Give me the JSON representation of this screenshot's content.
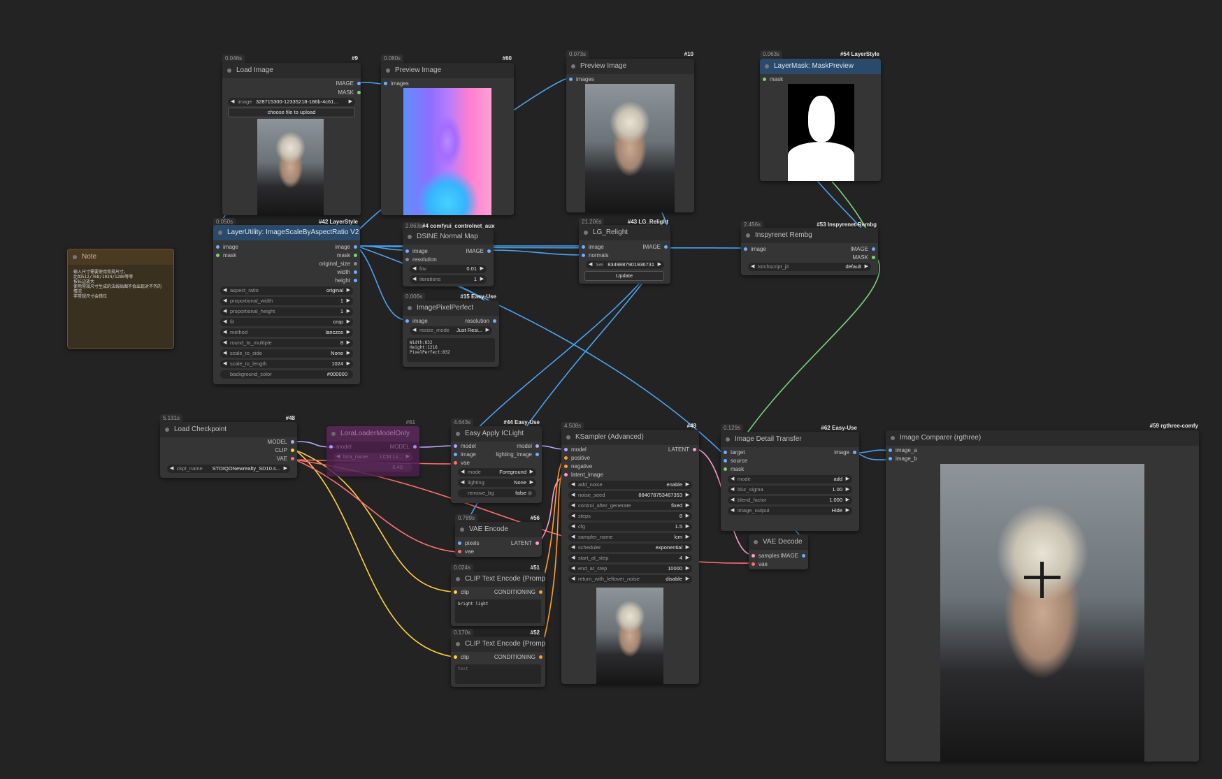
{
  "canvas": {
    "background": "#232323"
  },
  "nodes": {
    "load_image": {
      "time": "0.046s",
      "id": "#9",
      "title": "Load Image",
      "outputs": [
        "IMAGE",
        "MASK"
      ],
      "widget_image_label": "image",
      "widget_image_value": "328715300-12335218-186b-4c61...",
      "upload_button": "choose file to upload"
    },
    "preview_image_60": {
      "time": "0.080s",
      "id": "#60",
      "title": "Preview Image",
      "input": "images"
    },
    "preview_image_10": {
      "time": "0.073s",
      "id": "#10",
      "title": "Preview Image",
      "input": "images"
    },
    "mask_preview": {
      "time": "0.063s",
      "id": "#54 LayerStyle",
      "title": "LayerMask: MaskPreview",
      "input": "mask"
    },
    "scale_by_aspect": {
      "time": "0.050s",
      "id": "#42 LayerStyle",
      "title": "LayerUtility: ImageScaleByAspectRatio V2",
      "inputs": [
        "image",
        "mask"
      ],
      "outputs": [
        "image",
        "mask",
        "original_size",
        "width",
        "height"
      ],
      "widgets": [
        {
          "label": "aspect_ratio",
          "value": "original"
        },
        {
          "label": "proportional_width",
          "value": "1"
        },
        {
          "label": "proportional_height",
          "value": "1"
        },
        {
          "label": "fit",
          "value": "crop"
        },
        {
          "label": "method",
          "value": "lanczos"
        },
        {
          "label": "round_to_multiple",
          "value": "8"
        },
        {
          "label": "scale_to_side",
          "value": "None"
        },
        {
          "label": "scale_to_length",
          "value": "1024"
        },
        {
          "label": "background_color",
          "value": "#000000"
        }
      ]
    },
    "note": {
      "title": "Note",
      "text": "输入尺寸需要使用常规尺寸，\n比如512/768/1024/1280等等\n按长边放大\n使用常规尺寸生成的法线贴图不会出现对不齐的\n情况\n非常规尺寸会错位"
    },
    "dsine": {
      "time": "2.863s",
      "id": "#4 comfyui_controlnet_aux",
      "title": "DSINE Normal Map",
      "inputs": [
        "image",
        "resolution"
      ],
      "output": "IMAGE",
      "widgets": [
        {
          "label": "fov",
          "value": "0.01"
        },
        {
          "label": "iterations",
          "value": "1"
        }
      ]
    },
    "pixel_perfect": {
      "time": "0.006s",
      "id": "#15 Easy-Use",
      "title": "ImagePixelPerfect",
      "input": "image",
      "output": "resolution",
      "widget": {
        "label": "resize_mode",
        "value": "Just Resi..."
      },
      "text": "Width:832\nHeight:1216\nPixelPerfect:832"
    },
    "lg_relight": {
      "time": "21.206s",
      "id": "#43 LG_Relight",
      "title": "LG_Relight",
      "inputs": [
        "image",
        "normals"
      ],
      "output": "IMAGE",
      "widget_seed_label": "Sei",
      "widget_seed_value": "83498879019367​31",
      "update_button": "Update"
    },
    "rembg": {
      "time": "2.456s",
      "id": "#53 Inspyrenet-Rembg",
      "title": "Inspyrenet Rembg",
      "input": "image",
      "outputs": [
        "IMAGE",
        "MASK"
      ],
      "widget": {
        "label": "torchscript_jit",
        "value": "default"
      }
    },
    "load_checkpoint": {
      "time": "5.131s",
      "id": "#48",
      "title": "Load Checkpoint",
      "outputs": [
        "MODEL",
        "CLIP",
        "VAE"
      ],
      "widget": {
        "label": "ckpt_name",
        "value": "STOIQONewrealty_SD10.s..."
      }
    },
    "lora_loader": {
      "id": "#61",
      "title": "LoraLoaderModelOnly",
      "input": "model",
      "output": "MODEL",
      "widget1": {
        "label": "lora_name",
        "value": "LCM Lo..."
      },
      "widget2_value": "0.40"
    },
    "iclight": {
      "time": "4.643s",
      "id": "#44 Easy-Use",
      "title": "Easy Apply ICLight",
      "inputs": [
        "model",
        "image",
        "vae"
      ],
      "outputs": [
        "model",
        "lighting_image"
      ],
      "widgets": [
        {
          "label": "mode",
          "value": "Foreground"
        },
        {
          "label": "lighting",
          "value": "None"
        },
        {
          "label": "remove_bg",
          "value": "false"
        }
      ]
    },
    "vae_encode": {
      "time": "0.789s",
      "id": "#56",
      "title": "VAE Encode",
      "inputs": [
        "pixels",
        "vae"
      ],
      "output": "LATENT"
    },
    "clip_pos": {
      "time": "0.024s",
      "id": "#51",
      "title": "CLIP Text Encode (Prompt)",
      "input": "clip",
      "output": "CONDITIONING",
      "text": "bright light"
    },
    "clip_neg": {
      "time": "0.170s",
      "id": "#52",
      "title": "CLIP Text Encode (Prompt)",
      "input": "clip",
      "output": "CONDITIONING",
      "text": "text"
    },
    "ksampler": {
      "time": "4.508s",
      "id": "#49",
      "title": "KSampler (Advanced)",
      "inputs": [
        "model",
        "positive",
        "negative",
        "latent_image"
      ],
      "output": "LATENT",
      "widgets": [
        {
          "label": "add_noise",
          "value": "enable"
        },
        {
          "label": "noise_seed",
          "value": "884078753467353"
        },
        {
          "label": "control_after_generate",
          "value": "fixed"
        },
        {
          "label": "steps",
          "value": "8"
        },
        {
          "label": "cfg",
          "value": "1.5"
        },
        {
          "label": "sampler_name",
          "value": "lcm"
        },
        {
          "label": "scheduler",
          "value": "exponential"
        },
        {
          "label": "start_at_step",
          "value": "4"
        },
        {
          "label": "end_at_step",
          "value": "10000"
        },
        {
          "label": "return_with_leftover_noise",
          "value": "disable"
        }
      ]
    },
    "detail_transfer": {
      "time": "0.129s",
      "id": "#62 Easy-Use",
      "title": "Image Detail Transfer",
      "inputs": [
        "target",
        "source",
        "mask"
      ],
      "output": "image",
      "widgets": [
        {
          "label": "mode",
          "value": "add"
        },
        {
          "label": "blur_sigma",
          "value": "1.00"
        },
        {
          "label": "blend_factor",
          "value": "1.000"
        },
        {
          "label": "image_output",
          "value": "Hide"
        }
      ]
    },
    "vae_decode": {
      "title": "VAE Decode",
      "inputs": [
        "samples",
        "vae"
      ],
      "output": "IMAGE"
    },
    "comparer": {
      "id": "#59 rgthree-comfy",
      "title": "Image Comparer (rgthree)",
      "inputs": [
        "image_a",
        "image_b"
      ]
    }
  },
  "colors": {
    "link_image": "#4aa3f0",
    "link_mask": "#7ad27a",
    "link_clip": "#ffd23f",
    "link_vae": "#ff6f6f",
    "link_model": "#b9a6ff",
    "link_latent": "#ff9ccc",
    "link_cond": "#ff9e2b"
  }
}
